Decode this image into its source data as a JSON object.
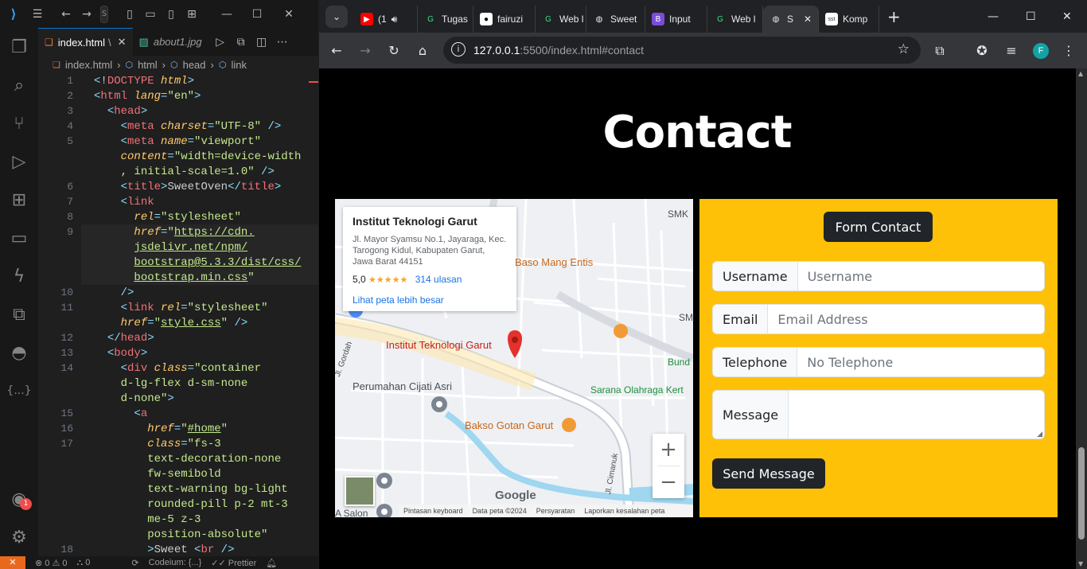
{
  "vscode": {
    "title_search": "S",
    "tabs": [
      {
        "label": "index.html",
        "suffix": "\\"
      },
      {
        "label": "about1.jpg"
      }
    ],
    "breadcrumb": [
      "index.html",
      "html",
      "head",
      "link"
    ],
    "lines": [
      {
        "n": "1",
        "html": "<span class=\"pu\">&lt;</span>!<span class=\"tg\">DOCTYPE</span> <span class=\"at\">html</span><span class=\"pu\">&gt;</span>"
      },
      {
        "n": "2",
        "html": "<span class=\"pu\">&lt;</span><span class=\"tg\">html</span> <span class=\"at\">lang</span><span class=\"pu\">=</span><span class=\"st\">\"en\"</span><span class=\"pu\">&gt;</span>"
      },
      {
        "n": "3",
        "html": "  <span class=\"pu\">&lt;</span><span class=\"tg\">head</span><span class=\"pu\">&gt;</span>"
      },
      {
        "n": "4",
        "html": "    <span class=\"pu\">&lt;</span><span class=\"tg\">meta</span> <span class=\"at\">charset</span><span class=\"pu\">=</span><span class=\"st\">\"UTF-8\"</span> <span class=\"pu\">/&gt;</span>"
      },
      {
        "n": "5",
        "html": "    <span class=\"pu\">&lt;</span><span class=\"tg\">meta</span> <span class=\"at\">name</span><span class=\"pu\">=</span><span class=\"st\">\"viewport\"</span>"
      },
      {
        "n": "",
        "html": "    <span class=\"at\">content</span><span class=\"pu\">=</span><span class=\"st\">\"width=device-width</span>"
      },
      {
        "n": "",
        "html": "    <span class=\"st\">, initial-scale=1.0\"</span> <span class=\"pu\">/&gt;</span>"
      },
      {
        "n": "6",
        "html": "    <span class=\"pu\">&lt;</span><span class=\"tg\">title</span><span class=\"pu\">&gt;</span>SweetOven<span class=\"pu\">&lt;/</span><span class=\"tg\">title</span><span class=\"pu\">&gt;</span>"
      },
      {
        "n": "7",
        "html": "    <span class=\"pu\">&lt;</span><span class=\"tg\">link</span>"
      },
      {
        "n": "8",
        "html": "      <span class=\"at\">rel</span><span class=\"pu\">=</span><span class=\"st\">\"stylesheet\"</span>"
      },
      {
        "n": "9",
        "html": "      <span class=\"at\">href</span><span class=\"pu\">=</span><span class=\"st\">\"<u>https://cdn.</u></span>"
      },
      {
        "n": "",
        "html": "      <span class=\"st\"><u>jsdelivr.net/npm/</u></span>"
      },
      {
        "n": "",
        "html": "      <span class=\"st\"><u>bootstrap@5.3.3/dist/css/</u></span>"
      },
      {
        "n": "",
        "html": "      <span class=\"st\"><u>bootstrap.min.css</u>\"</span>"
      },
      {
        "n": "10",
        "html": "    <span class=\"pu\">/&gt;</span>"
      },
      {
        "n": "11",
        "html": "    <span class=\"pu\">&lt;</span><span class=\"tg\">link</span> <span class=\"at\">rel</span><span class=\"pu\">=</span><span class=\"st\">\"stylesheet\"</span>"
      },
      {
        "n": "",
        "html": "    <span class=\"at\">href</span><span class=\"pu\">=</span><span class=\"st\">\"<u>style.css</u>\"</span> <span class=\"pu\">/&gt;</span>"
      },
      {
        "n": "12",
        "html": "  <span class=\"pu\">&lt;/</span><span class=\"tg\">head</span><span class=\"pu\">&gt;</span>"
      },
      {
        "n": "13",
        "html": "  <span class=\"pu\">&lt;</span><span class=\"tg\">body</span><span class=\"pu\">&gt;</span>"
      },
      {
        "n": "14",
        "html": "    <span class=\"pu\">&lt;</span><span class=\"tg\">div</span> <span class=\"at\">class</span><span class=\"pu\">=</span><span class=\"st\">\"container</span>"
      },
      {
        "n": "",
        "html": "    <span class=\"st\">d-lg-flex d-sm-none</span>"
      },
      {
        "n": "",
        "html": "    <span class=\"st\">d-none\"</span><span class=\"pu\">&gt;</span>"
      },
      {
        "n": "15",
        "html": "      <span class=\"pu\">&lt;</span><span class=\"tg\">a</span>"
      },
      {
        "n": "16",
        "html": "        <span class=\"at\">href</span><span class=\"pu\">=</span><span class=\"st\">\"<u>#home</u>\"</span>"
      },
      {
        "n": "17",
        "html": "        <span class=\"at\">class</span><span class=\"pu\">=</span><span class=\"st\">\"fs-3</span>"
      },
      {
        "n": "",
        "html": "        <span class=\"st\">text-decoration-none</span>"
      },
      {
        "n": "",
        "html": "        <span class=\"st\">fw-semibold</span>"
      },
      {
        "n": "",
        "html": "        <span class=\"st\">text-warning bg-light</span>"
      },
      {
        "n": "",
        "html": "        <span class=\"st\">rounded-pill p-2 mt-3</span>"
      },
      {
        "n": "",
        "html": "        <span class=\"st\">me-5 z-3</span>"
      },
      {
        "n": "",
        "html": "        <span class=\"st\">position-absolute\"</span>"
      },
      {
        "n": "18",
        "html": "        <span class=\"pu\">&gt;</span>Sweet <span class=\"pu\">&lt;</span><span class=\"tg\">br</span> <span class=\"pu\">/&gt;</span>"
      }
    ],
    "status": {
      "errors": "0",
      "warnings": "0",
      "ports": "0",
      "codeium": "Codeium: {...}",
      "prettier": "Prettier",
      "account_badge": "1"
    }
  },
  "chrome": {
    "tabs": [
      {
        "label": "(1",
        "fav": "youtube"
      },
      {
        "label": "Tugas",
        "fav": "g"
      },
      {
        "label": "fairuzi",
        "fav": "github"
      },
      {
        "label": "Web l",
        "fav": "g"
      },
      {
        "label": "Sweet",
        "fav": "globe"
      },
      {
        "label": "Input",
        "fav": "b"
      },
      {
        "label": "Web l",
        "fav": "g"
      },
      {
        "label": "S",
        "fav": "globe",
        "active": true
      },
      {
        "label": "Komp",
        "fav": "sst"
      }
    ],
    "url_host": "127.0.0.1",
    "url_rest": ":5500/index.html#contact",
    "profile_initial": "F"
  },
  "page": {
    "title": "Contact",
    "map": {
      "place_name": "Institut Teknologi Garut",
      "address": "Jl. Mayor Syamsu No.1, Jayaraga, Kec. Tarogong Kidul, Kabupaten Garut, Jawa Barat 44151",
      "rating": "5,0",
      "stars": "★★★★★",
      "reviews": "314 ulasan",
      "bigger_map": "Lihat peta lebih besar",
      "labels": {
        "baso": "Baso Mang Entis",
        "pin": "Institut Teknologi Garut",
        "cijati": "Perumahan Cijati Asri",
        "bakso": "Bakso Gotan Garut",
        "sarana": "Sarana Olahraga Kert",
        "bund": "Bund",
        "smk": "SMK",
        "sm": "SM",
        "gordah": "Jl. Gordah",
        "cimanuk": "Jl. Cimanuk",
        "salon": "A Salon"
      },
      "footer": {
        "keyboard": "Pintasan keyboard",
        "data": "Data peta ©2024",
        "terms": "Persyaratan",
        "report": "Laporkan kesalahan peta"
      },
      "google": "Google",
      "zoom_in": "+",
      "zoom_out": "−"
    },
    "form": {
      "heading": "Form Contact",
      "username_label": "Username",
      "username_placeholder": "Username",
      "email_label": "Email",
      "email_placeholder": "Email Address",
      "phone_label": "Telephone",
      "phone_placeholder": "No Telephone",
      "message_label": "Message",
      "submit": "Send Message"
    }
  },
  "colors": {
    "accent": "#ffc107",
    "dark_button": "#212529",
    "vscode_blue": "#0078d4"
  }
}
